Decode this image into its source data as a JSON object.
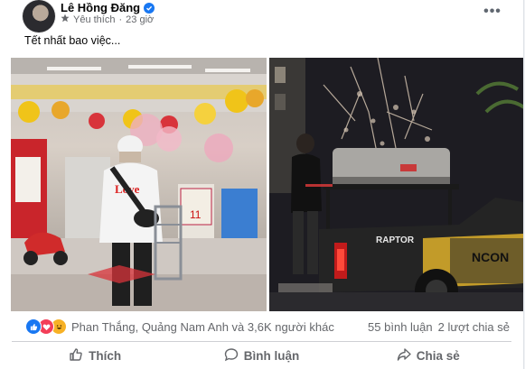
{
  "post": {
    "author": "Lê Hồng Đăng",
    "like_label": "Yêu thích",
    "separator": "·",
    "time": "23 giờ",
    "text": "Tết nhất bao việc..."
  },
  "photos": {
    "left_banner": "Love",
    "left_sign": "11",
    "right_plate": "RAPTOR",
    "right_brand": "NCON"
  },
  "reactions": {
    "names": "Phan Thắng, Quảng Nam Anh và 3,6K người khác",
    "comments": "55 bình luận",
    "shares": "2 lượt chia sẻ"
  },
  "actions": {
    "like": "Thích",
    "comment": "Bình luận",
    "share": "Chia sẻ"
  },
  "colors": {
    "accent": "#1877f2",
    "text_secondary": "#65676b"
  }
}
